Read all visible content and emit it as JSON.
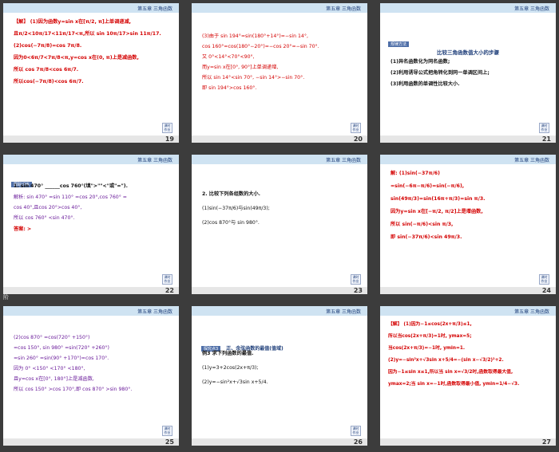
{
  "header": {
    "chapter_label": "第五章 三角函数"
  },
  "button": {
    "label": "课时作业"
  },
  "gutter_text": "阶",
  "slides": [
    {
      "number": "19",
      "lines": [
        {
          "t": "【解】 (1)因为函数y=sin x在[π/2, π]上单调递减,",
          "c": "red"
        },
        {
          "t": "且π/2<10π/17<11π/17<π,所以 sin 10π/17>sin 11π/17.",
          "c": "red"
        },
        {
          "t": "(2)cos(−7π/8)=cos 7π/8.",
          "c": "red"
        },
        {
          "t": "因为0<6π/7<7π/8<π,y=cos x在(0, π)上是减函数,",
          "c": "red"
        },
        {
          "t": "所以 cos 7π/8<cos 6π/7.",
          "c": "red"
        },
        {
          "t": "所以cos(−7π/8)<cos 6π/7.",
          "c": "red"
        }
      ]
    },
    {
      "number": "20",
      "lines": [
        {
          "t": "(3)由于 sin 194°=sin(180°+14°)=−sin 14°,",
          "c": "red"
        },
        {
          "t": "cos 160°=cos(180°−20°)=−cos 20°=−sin 70°.",
          "c": "red"
        },
        {
          "t": "又 0°<14°<70°<90°,",
          "c": "red"
        },
        {
          "t": "而y=sin x在[0°, 90°]上单调递增,",
          "c": "red"
        },
        {
          "t": "所以 sin 14°<sin 70°, −sin 14°>−sin 70°.",
          "c": "red"
        },
        {
          "t": "即 sin 194°>cos 160°.",
          "c": "red"
        }
      ]
    },
    {
      "number": "21",
      "tag": "规律方法",
      "title": "比较三角函数值大小的步骤",
      "lines": [
        {
          "t": "(1)异名函数化为同名函数;",
          "c": "blk"
        },
        {
          "t": "(2)利用诱导公式把角转化到同一单调区间上;",
          "c": "blk"
        },
        {
          "t": "(3)利用函数的单调性比较大小.",
          "c": "blk"
        }
      ]
    },
    {
      "number": "22",
      "tag": "跟踪训练",
      "lines": [
        {
          "t": "1. sin 470° ______cos 760°(填\">\"\"<\"或\"=\").",
          "c": "blk"
        },
        {
          "t": "解析: sin 470° =sin 110° =cos 20°,cos 760° =",
          "c": "purple"
        },
        {
          "t": "cos 40°,且cos 20°>cos 40°,",
          "c": "purple"
        },
        {
          "t": "所以 cos 760° <sin 470°.",
          "c": "purple"
        },
        {
          "t": "答案: >",
          "c": "red"
        }
      ]
    },
    {
      "number": "23",
      "lines": [
        {
          "t": "2. 比较下列各组数的大小.",
          "c": "blk"
        },
        {
          "t": "(1)sin(−37π/6)与sin(49π/3);",
          "c": "blk"
        },
        {
          "t": "(2)cos 870°与 sin 980°.",
          "c": "blk"
        }
      ]
    },
    {
      "number": "24",
      "lines": [
        {
          "t": "解: (1)sin(−37π/6)",
          "c": "red"
        },
        {
          "t": "=sin(−6π−π/6)=sin(−π/6),",
          "c": "red"
        },
        {
          "t": "sin(49π/3)=sin(16π+π/3)=sin π/3.",
          "c": "red"
        },
        {
          "t": "因为y=sin x在[−π/2, π/2]上是增函数,",
          "c": "red"
        },
        {
          "t": "所以 sin(−π/6)<sin π/3,",
          "c": "red"
        },
        {
          "t": "即 sin(−37π/6)<sin 49π/3.",
          "c": "red"
        }
      ]
    },
    {
      "number": "25",
      "lines": [
        {
          "t": "(2)cos 870° =cos(720° +150°)",
          "c": "purple"
        },
        {
          "t": "=cos 150°, sin 980° =sin(720° +260°)",
          "c": "purple"
        },
        {
          "t": "=sin 260° =sin(90° +170°)=cos 170°.",
          "c": "purple"
        },
        {
          "t": "因为 0° <150° <170° <180°,",
          "c": "purple"
        },
        {
          "t": "且y=cos x在[0°, 180°]上是减函数,",
          "c": "purple"
        },
        {
          "t": "所以 cos 150° >cos 170°,即 cos 870° >sin 980°.",
          "c": "purple"
        }
      ]
    },
    {
      "number": "26",
      "tag": "探究点3",
      "heading": "正、余弦函数的最值(值域)",
      "lines": [
        {
          "t": "例3 求下列函数的最值.",
          "c": "blk"
        },
        {
          "t": "(1)y=3+2cos(2x+π/3);",
          "c": "blk"
        },
        {
          "t": "(2)y=−sin²x+√3sin x+5/4.",
          "c": "blk"
        }
      ]
    },
    {
      "number": "27",
      "lines": [
        {
          "t": "【解】 (1)因为−1≤cos(2x+π/3)≤1,",
          "c": "red"
        },
        {
          "t": "所以当cos(2x+π/3)=1时, ymax=5;",
          "c": "red"
        },
        {
          "t": "当cos(2x+π/3)=−1时, ymin=1.",
          "c": "red"
        },
        {
          "t": "(2)y=−sin²x+√3sin x+5/4=−(sin x−√3/2)²+2.",
          "c": "red"
        },
        {
          "t": "因为−1≤sin x≤1,所以当 sin x=√3/2时,函数取得最大值,",
          "c": "red"
        },
        {
          "t": "ymax=2;当 sin x=−1时,函数取得最小值, ymin=1/4−√3.",
          "c": "red"
        }
      ]
    }
  ]
}
